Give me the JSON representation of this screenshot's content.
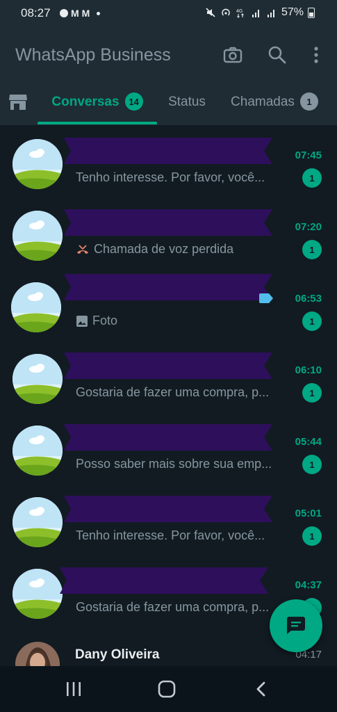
{
  "status_bar": {
    "time": "08:27",
    "battery": "57%",
    "left_icons": [
      "notification-icon",
      "gmail-icon",
      "gmail-icon",
      "dot-icon"
    ],
    "right_icons": [
      "mute-icon",
      "hotspot-icon",
      "4g-icon",
      "signal-icon",
      "signal-icon",
      "battery-icon"
    ]
  },
  "header": {
    "title": "WhatsApp Business",
    "icons": [
      "camera-icon",
      "search-icon",
      "menu-icon"
    ]
  },
  "tabs": [
    {
      "label": "",
      "icon": "store-icon"
    },
    {
      "label": "Conversas",
      "badge": "14",
      "active": true
    },
    {
      "label": "Status"
    },
    {
      "label": "Chamadas",
      "badge": "1"
    }
  ],
  "chats": [
    {
      "name": "",
      "preview": "Tenho interesse. Por favor, você...",
      "time": "07:45",
      "unread": "1"
    },
    {
      "name": "",
      "preview": "Chamada de voz perdida",
      "time": "07:20",
      "unread": "1",
      "preview_icon": "missed-call-icon"
    },
    {
      "name": "",
      "preview": "Foto",
      "time": "06:53",
      "unread": "1",
      "preview_icon": "photo-icon",
      "label_icon": "label-icon"
    },
    {
      "name": "",
      "preview": "Gostaria de fazer uma compra, p...",
      "time": "06:10",
      "unread": "1"
    },
    {
      "name": "",
      "preview": "Posso saber mais sobre sua emp...",
      "time": "05:44",
      "unread": "1"
    },
    {
      "name": "",
      "preview": "Tenho interesse. Por favor, você...",
      "time": "05:01",
      "unread": "1"
    },
    {
      "name": "",
      "preview": "Gostaria de fazer uma compra, p...",
      "time": "04:37",
      "unread": "1"
    },
    {
      "name": "Dany Oliveira",
      "preview": "",
      "time": "04:17",
      "unread": ""
    }
  ],
  "colors": {
    "accent": "#00a884",
    "background": "#121b22",
    "header": "#1f2c34",
    "redaction": "#2e0f5c"
  },
  "fab": {
    "icon": "new-chat-icon"
  },
  "nav": [
    "recent-apps-icon",
    "home-icon",
    "back-icon"
  ]
}
